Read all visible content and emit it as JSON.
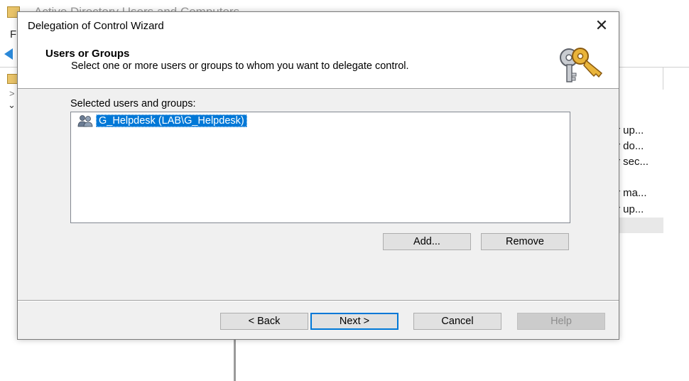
{
  "background_app": {
    "title": "Active Directory Users and Computers",
    "menu_first_letter": "F",
    "tree_chevrons": [
      ">",
      "⌄"
    ],
    "right_pane_items": [
      "r up...",
      "r do...",
      "r sec...",
      "r ma...",
      "r up..."
    ]
  },
  "dialog": {
    "title": "Delegation of Control Wizard",
    "close_glyph": "✕",
    "header": {
      "title": "Users or Groups",
      "subtitle": "Select one or more users or groups to whom you want to delegate control.",
      "icon": "keys-icon"
    },
    "list": {
      "label": "Selected users and groups:",
      "items": [
        {
          "text": "G_Helpdesk (LAB\\G_Helpdesk)",
          "icon": "group-icon",
          "selected": true
        }
      ]
    },
    "buttons": {
      "add": "Add...",
      "remove": "Remove",
      "back": "< Back",
      "next": "Next >",
      "cancel": "Cancel",
      "help": "Help"
    }
  },
  "colors": {
    "selection": "#0078d7",
    "dialog_bg": "#f0f0f0",
    "button_bg": "#e1e1e1",
    "disabled_button_bg": "#cccccc"
  }
}
